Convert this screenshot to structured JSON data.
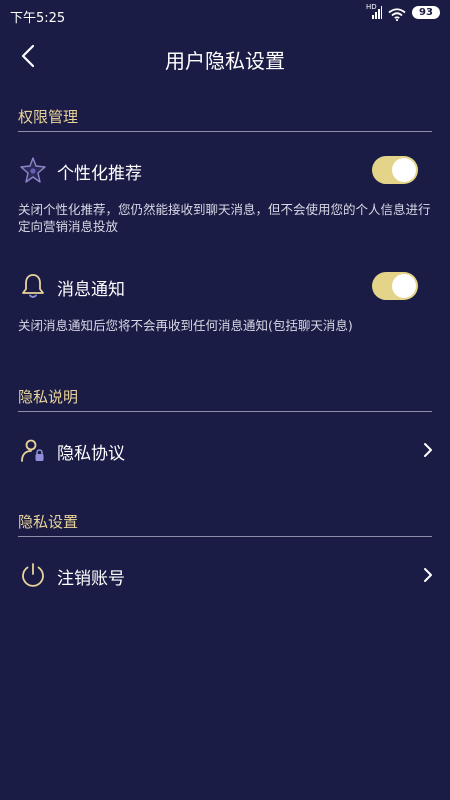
{
  "status_bar": {
    "time": "下午5:25",
    "network": "HD",
    "battery": "93"
  },
  "header": {
    "title": "用户隐私设置"
  },
  "sections": {
    "permissions": {
      "title": "权限管理",
      "personalized": {
        "label": "个性化推荐",
        "enabled": true,
        "description": "关闭个性化推荐，您仍然能接收到聊天消息，但不会使用您的个人信息进行定向营销消息投放"
      },
      "notifications": {
        "label": "消息通知",
        "enabled": true,
        "description": "关闭消息通知后您将不会再收到任何消息通知(包括聊天消息)"
      }
    },
    "privacy_info": {
      "title": "隐私说明",
      "agreement_label": "隐私协议"
    },
    "privacy_settings": {
      "title": "隐私设置",
      "deregister_label": "注销账号"
    }
  },
  "colors": {
    "background": "#1b1c45",
    "accent": "#e8d49a",
    "toggle_on": "#e3d489",
    "divider": "#8f90a8"
  },
  "icons": {
    "personalized": "sparkle-star-icon",
    "notifications": "bell-icon",
    "agreement": "user-lock-icon",
    "deregister": "power-icon"
  }
}
